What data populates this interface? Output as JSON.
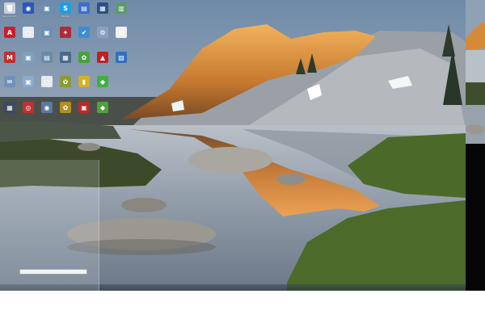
{
  "desktop": {
    "icons": [
      {
        "id": "r0c0",
        "glyph": "🗑",
        "color": "#c8d0dc",
        "label": "Recycle Bin"
      },
      {
        "id": "r0c1",
        "glyph": "◉",
        "color": "#2a57b8",
        "label": ""
      },
      {
        "id": "r0c2",
        "glyph": "▣",
        "color": "#6a8fb0",
        "label": ""
      },
      {
        "id": "r0c3",
        "glyph": "S",
        "color": "#1aa0e0",
        "label": "Skype"
      },
      {
        "id": "r0c4",
        "glyph": "▤",
        "color": "#3b6fc9",
        "label": ""
      },
      {
        "id": "r0c5",
        "glyph": "▦",
        "color": "#2d4f8c",
        "label": ""
      },
      {
        "id": "r0c6",
        "glyph": "▥",
        "color": "#5a9a6a",
        "label": ""
      },
      {
        "id": "r1c0",
        "glyph": "A",
        "color": "#c8202a",
        "label": ""
      },
      {
        "id": "r1c1",
        "glyph": "▢",
        "color": "#e8ecf2",
        "label": ""
      },
      {
        "id": "r1c2",
        "glyph": "▣",
        "color": "#6b8fb6",
        "label": ""
      },
      {
        "id": "r1c3",
        "glyph": "✦",
        "color": "#b02a3a",
        "label": ""
      },
      {
        "id": "r1c4",
        "glyph": "✔",
        "color": "#3c8ed0",
        "label": ""
      },
      {
        "id": "r1c5",
        "glyph": "⚙",
        "color": "#8aa0c0",
        "label": ""
      },
      {
        "id": "r1c6",
        "glyph": "▤",
        "color": "#f0f0f0",
        "label": ""
      },
      {
        "id": "r2c0",
        "glyph": "M",
        "color": "#c03030",
        "label": ""
      },
      {
        "id": "r2c1",
        "glyph": "▣",
        "color": "#7f9fc0",
        "label": ""
      },
      {
        "id": "r2c2",
        "glyph": "▤",
        "color": "#6a8aa8",
        "label": ""
      },
      {
        "id": "r2c3",
        "glyph": "▦",
        "color": "#4a6a8a",
        "label": ""
      },
      {
        "id": "r2c4",
        "glyph": "✿",
        "color": "#4aa040",
        "label": ""
      },
      {
        "id": "r2c5",
        "glyph": "▲",
        "color": "#c02020",
        "label": ""
      },
      {
        "id": "r2c6",
        "glyph": "▧",
        "color": "#3070c0",
        "label": ""
      },
      {
        "id": "r3c0",
        "glyph": "✉",
        "color": "#7090b8",
        "label": ""
      },
      {
        "id": "r3c1",
        "glyph": "▣",
        "color": "#8aaace",
        "label": ""
      },
      {
        "id": "r3c2",
        "glyph": "▢",
        "color": "#e6e9ee",
        "label": ""
      },
      {
        "id": "r3c3",
        "glyph": "✿",
        "color": "#8a9a30",
        "label": ""
      },
      {
        "id": "r3c4",
        "glyph": "▮",
        "color": "#d8b020",
        "label": ""
      },
      {
        "id": "r3c5",
        "glyph": "◆",
        "color": "#40b040",
        "label": ""
      },
      {
        "id": "r4c0",
        "glyph": "▦",
        "color": "#3a4a60",
        "label": ""
      },
      {
        "id": "r4c1",
        "glyph": "◎",
        "color": "#c03030",
        "label": ""
      },
      {
        "id": "r4c2",
        "glyph": "◉",
        "color": "#5a7aa0",
        "label": ""
      },
      {
        "id": "r4c3",
        "glyph": "✿",
        "color": "#b09020",
        "label": ""
      },
      {
        "id": "r4c4",
        "glyph": "▣",
        "color": "#c02828",
        "label": ""
      },
      {
        "id": "r4c5",
        "glyph": "◆",
        "color": "#50a040",
        "label": ""
      }
    ]
  },
  "peek": {
    "tooltip": ""
  }
}
